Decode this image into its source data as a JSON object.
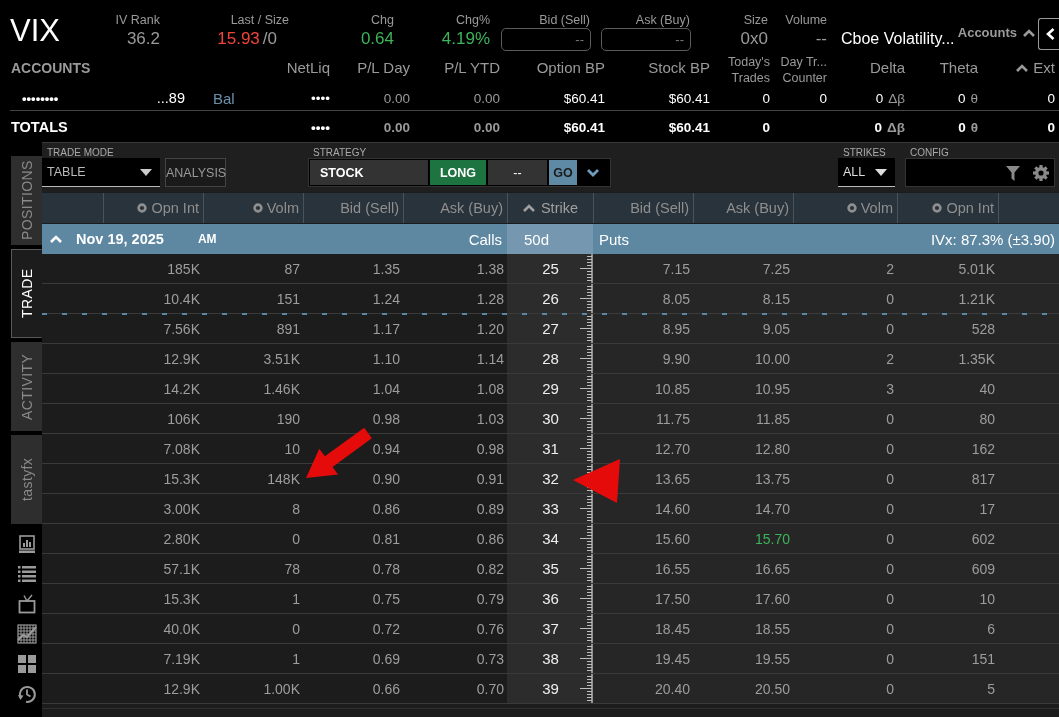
{
  "quote": {
    "symbol": "VIX",
    "iv_rank": {
      "label": "IV Rank",
      "value": "36.2"
    },
    "last_size": {
      "label": "Last / Size",
      "last": "15.93",
      "size": "/0",
      "rising": false
    },
    "chg": {
      "label": "Chg",
      "value": "0.64",
      "rising": true
    },
    "chg_pct": {
      "label": "Chg%",
      "value": "4.19%",
      "rising": true
    },
    "bid": {
      "label": "Bid (Sell)",
      "value": "--"
    },
    "ask": {
      "label": "Ask (Buy)",
      "value": "--"
    },
    "size": {
      "label": "Size",
      "value": "0x0"
    },
    "volume": {
      "label": "Volume",
      "value": "--"
    },
    "description": "Cboe Volatility..."
  },
  "accounts_toggle": {
    "label": "Accounts",
    "expanded": true
  },
  "accounts": {
    "title": "ACCOUNTS",
    "columns": [
      {
        "lines": [
          "NetLiq"
        ],
        "kind": "value",
        "sorted": false
      },
      {
        "lines": [
          "P/L Day"
        ],
        "kind": "pl",
        "sorted": false
      },
      {
        "lines": [
          "P/L YTD"
        ],
        "kind": "pl",
        "sorted": false
      },
      {
        "lines": [
          "Option BP"
        ],
        "kind": "value",
        "sorted": false
      },
      {
        "lines": [
          "Stock BP"
        ],
        "kind": "value",
        "sorted": false
      },
      {
        "lines": [
          "Today's",
          "Trades"
        ],
        "kind": "value",
        "sorted": false
      },
      {
        "lines": [
          "Day Tr...",
          "Counter"
        ],
        "kind": "value",
        "sorted": false
      },
      {
        "lines": [
          "Delta"
        ],
        "kind": "value",
        "sorted": false
      },
      {
        "lines": [
          "Theta"
        ],
        "kind": "value",
        "sorted": false
      },
      {
        "lines": [
          "Ext"
        ],
        "kind": "value",
        "sorted": true
      }
    ],
    "rows": [
      {
        "mask": "••••••••",
        "account": "...89",
        "type": "Bal",
        "cells": [
          {
            "text": "••••"
          },
          {
            "text": "0.00"
          },
          {
            "text": "0.00"
          },
          {
            "text": "$60.41"
          },
          {
            "text": "$60.41"
          },
          {
            "text": "0"
          },
          {
            "text": "0"
          },
          {
            "text": "0",
            "unit": "Δβ"
          },
          {
            "text": "0",
            "unit": "θ"
          },
          {
            "text": "0"
          }
        ]
      }
    ],
    "totals": {
      "label": "TOTALS",
      "cells": [
        {
          "text": "••••"
        },
        {
          "text": "0.00"
        },
        {
          "text": "0.00"
        },
        {
          "text": "$60.41"
        },
        {
          "text": "$60.41"
        },
        {
          "text": "0"
        },
        null,
        {
          "text": "0",
          "unit": "Δβ"
        },
        {
          "text": "0",
          "unit": "θ"
        },
        {
          "text": "0"
        }
      ]
    }
  },
  "sidebar": {
    "tabs": [
      {
        "label": "POSITIONS",
        "selected": false
      },
      {
        "label": "TRADE",
        "selected": true
      },
      {
        "label": "ACTIVITY",
        "selected": false
      },
      {
        "label": "tastyfx",
        "selected": false
      }
    ]
  },
  "toolbar": {
    "trade_mode": {
      "label": "TRADE MODE",
      "value": "TABLE"
    },
    "analysis": {
      "label": "ANALYSIS"
    },
    "strategy": {
      "label": "STRATEGY",
      "type": "STOCK",
      "side": {
        "label": "LONG",
        "kind": "long"
      },
      "quantity": "--",
      "go": "GO"
    },
    "strikes": {
      "label": "STRIKES",
      "value": "ALL"
    },
    "config": {
      "label": "CONFIG"
    }
  },
  "chain": {
    "calls_columns": [
      {
        "label": "Opn Int",
        "kind": "stat"
      },
      {
        "label": "Volm",
        "kind": "stat"
      },
      {
        "label": "Bid (Sell)",
        "kind": "price"
      },
      {
        "label": "Ask (Buy)",
        "kind": "price"
      }
    ],
    "strike_column": {
      "label": "Strike",
      "sorted": true
    },
    "puts_columns": [
      {
        "label": "Bid (Sell)",
        "kind": "price"
      },
      {
        "label": "Ask (Buy)",
        "kind": "price"
      },
      {
        "label": "Volm",
        "kind": "stat"
      },
      {
        "label": "Opn Int",
        "kind": "stat"
      }
    ],
    "expiration": {
      "date": "Nov 19, 2025",
      "session": "AM",
      "calls_label": "Calls",
      "days": "50d",
      "puts_label": "Puts",
      "ivx": "IVx: 87.3% (±3.90)",
      "expanded": true
    },
    "rows": [
      {
        "strike": "25",
        "calls": [
          "185K",
          "87",
          "1.35",
          "1.38"
        ],
        "puts": [
          "7.15",
          "7.25",
          "2",
          "5.01K"
        ],
        "price_line_above": false,
        "marked": false,
        "put_ask_uptick": false
      },
      {
        "strike": "26",
        "calls": [
          "10.4K",
          "151",
          "1.24",
          "1.28"
        ],
        "puts": [
          "8.05",
          "8.15",
          "0",
          "1.21K"
        ],
        "price_line_above": false,
        "marked": false,
        "put_ask_uptick": false
      },
      {
        "strike": "27",
        "calls": [
          "7.56K",
          "891",
          "1.17",
          "1.20"
        ],
        "puts": [
          "8.95",
          "9.05",
          "0",
          "528"
        ],
        "price_line_above": true,
        "marked": false,
        "put_ask_uptick": false
      },
      {
        "strike": "28",
        "calls": [
          "12.9K",
          "3.51K",
          "1.10",
          "1.14"
        ],
        "puts": [
          "9.90",
          "10.00",
          "2",
          "1.35K"
        ],
        "price_line_above": false,
        "marked": false,
        "put_ask_uptick": false
      },
      {
        "strike": "29",
        "calls": [
          "14.2K",
          "1.46K",
          "1.04",
          "1.08"
        ],
        "puts": [
          "10.85",
          "10.95",
          "3",
          "40"
        ],
        "price_line_above": false,
        "marked": false,
        "put_ask_uptick": false
      },
      {
        "strike": "30",
        "calls": [
          "106K",
          "190",
          "0.98",
          "1.03"
        ],
        "puts": [
          "11.75",
          "11.85",
          "0",
          "80"
        ],
        "price_line_above": false,
        "marked": false,
        "put_ask_uptick": false
      },
      {
        "strike": "31",
        "calls": [
          "7.08K",
          "10",
          "0.94",
          "0.98"
        ],
        "puts": [
          "12.70",
          "12.80",
          "0",
          "162"
        ],
        "price_line_above": false,
        "marked": false,
        "put_ask_uptick": false
      },
      {
        "strike": "32",
        "calls": [
          "15.3K",
          "148K",
          "0.90",
          "0.91"
        ],
        "puts": [
          "13.65",
          "13.75",
          "0",
          "817"
        ],
        "price_line_above": false,
        "marked": true,
        "put_ask_uptick": false
      },
      {
        "strike": "33",
        "calls": [
          "3.00K",
          "8",
          "0.86",
          "0.89"
        ],
        "puts": [
          "14.60",
          "14.70",
          "0",
          "17"
        ],
        "price_line_above": false,
        "marked": false,
        "put_ask_uptick": false
      },
      {
        "strike": "34",
        "calls": [
          "2.80K",
          "0",
          "0.81",
          "0.86"
        ],
        "puts": [
          "15.60",
          "15.70",
          "0",
          "602"
        ],
        "price_line_above": false,
        "marked": false,
        "put_ask_uptick": true
      },
      {
        "strike": "35",
        "calls": [
          "57.1K",
          "78",
          "0.78",
          "0.82"
        ],
        "puts": [
          "16.55",
          "16.65",
          "0",
          "609"
        ],
        "price_line_above": false,
        "marked": false,
        "put_ask_uptick": false
      },
      {
        "strike": "36",
        "calls": [
          "15.3K",
          "1",
          "0.75",
          "0.79"
        ],
        "puts": [
          "17.50",
          "17.60",
          "0",
          "10"
        ],
        "price_line_above": false,
        "marked": false,
        "put_ask_uptick": false
      },
      {
        "strike": "37",
        "calls": [
          "40.0K",
          "0",
          "0.72",
          "0.76"
        ],
        "puts": [
          "18.45",
          "18.55",
          "0",
          "6"
        ],
        "price_line_above": false,
        "marked": false,
        "put_ask_uptick": false
      },
      {
        "strike": "38",
        "calls": [
          "7.19K",
          "1",
          "0.69",
          "0.73"
        ],
        "puts": [
          "19.45",
          "19.55",
          "0",
          "151"
        ],
        "price_line_above": false,
        "marked": false,
        "put_ask_uptick": false
      },
      {
        "strike": "39",
        "calls": [
          "12.9K",
          "1.00K",
          "0.66",
          "0.70"
        ],
        "puts": [
          "20.40",
          "20.50",
          "0",
          "5"
        ],
        "price_line_above": false,
        "marked": false,
        "put_ask_uptick": false
      }
    ]
  }
}
